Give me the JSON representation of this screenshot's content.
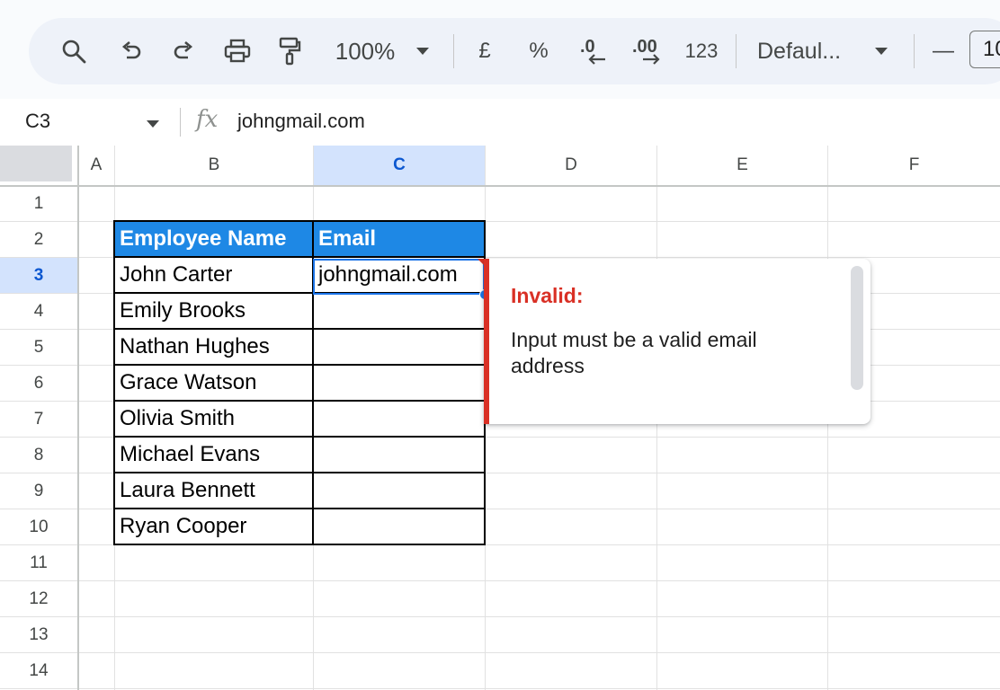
{
  "toolbar": {
    "zoom": "100%",
    "currency": "£",
    "percent": "%",
    "number_format": "123",
    "font": "Defaul...",
    "minus": "—",
    "font_size": "10"
  },
  "formula_bar": {
    "cell_ref": "C3",
    "fx": "fx",
    "value": "johngmail.com"
  },
  "grid": {
    "columns": [
      "A",
      "B",
      "C",
      "D",
      "E",
      "F"
    ],
    "selected_column": "C",
    "rows": [
      "1",
      "2",
      "3",
      "4",
      "5",
      "6",
      "7",
      "8",
      "9",
      "10",
      "11",
      "12",
      "13",
      "14"
    ],
    "selected_row": "3"
  },
  "table": {
    "headers": [
      "Employee Name",
      "Email"
    ],
    "rows": [
      [
        "John Carter",
        "johngmail.com"
      ],
      [
        "Emily Brooks",
        ""
      ],
      [
        "Nathan Hughes",
        ""
      ],
      [
        "Grace Watson",
        ""
      ],
      [
        "Olivia Smith",
        ""
      ],
      [
        "Michael Evans",
        ""
      ],
      [
        "Laura Bennett",
        ""
      ],
      [
        "Ryan Cooper",
        ""
      ]
    ]
  },
  "validation_popup": {
    "title": "Invalid:",
    "message": "Input must be a valid email address"
  },
  "colors": {
    "header_fill": "#1e88e5",
    "selection": "#1a73e8",
    "error": "#d93025",
    "toolbar_bg": "#eef2f9"
  },
  "icons": [
    "search-icon",
    "undo-icon",
    "redo-icon",
    "print-icon",
    "paint-format-icon",
    "dropdown-arrow-icon",
    "decrease-decimal-icon",
    "increase-decimal-icon"
  ]
}
